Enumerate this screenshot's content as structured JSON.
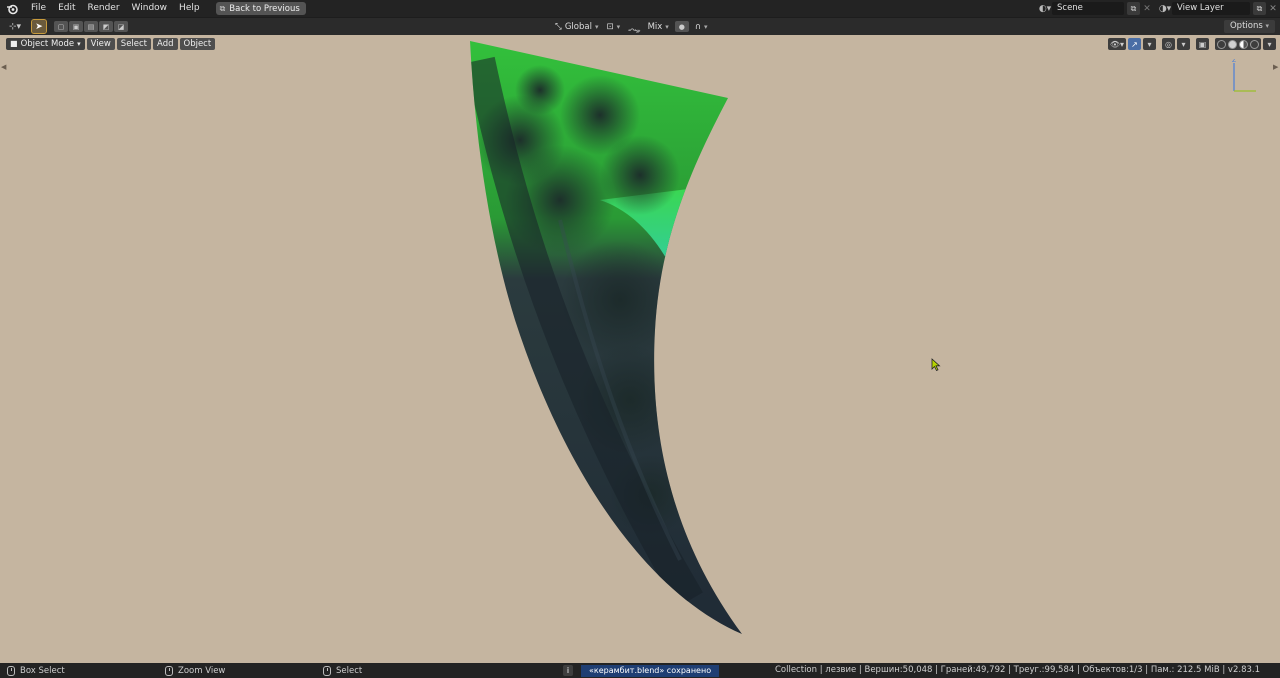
{
  "menu": {
    "items": [
      "File",
      "Edit",
      "Render",
      "Window",
      "Help"
    ],
    "back_label": "Back to Previous"
  },
  "top_right": {
    "scene_label": "Scene",
    "view_layer_label": "View Layer"
  },
  "header": {
    "transform_orientation": "Global",
    "snap_mode": "Mix",
    "options_label": "Options"
  },
  "viewport": {
    "mode_label": "Object Mode",
    "menu": [
      "View",
      "Select",
      "Add",
      "Object"
    ],
    "background_color": "#c5b5a0",
    "gizmo_axis": "Z"
  },
  "status": {
    "left_action": "Box Select",
    "middle_action": "Zoom View",
    "right_action": "Select",
    "saved_message": "«керамбит.blend» сохранено",
    "stats": "Collection | лезвие | Вершин:50,048 | Граней:49,792 | Треуг.:99,584 | Объектов:1/3 | Пам.: 212.5 MiB | v2.83.1"
  },
  "colors": {
    "accent_select": "#c89b3c",
    "accent_blue": "#4a6ea6",
    "saved_bg": "#1f3e73"
  }
}
